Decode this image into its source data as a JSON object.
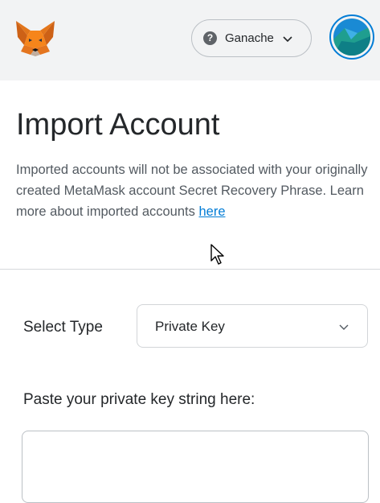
{
  "header": {
    "logo_icon": "metamask-fox-icon",
    "network": {
      "icon": "question-circle-icon",
      "label": "Ganache",
      "chevron_icon": "chevron-down-icon"
    },
    "avatar": {
      "icon": "account-identicon",
      "ring_color": "#037dd6"
    }
  },
  "page": {
    "title": "Import Account",
    "description": "Imported accounts will not be associated with your originally created MetaMask account Secret Recovery Phrase. Learn more about imported accounts ",
    "learn_more_link": "here"
  },
  "form": {
    "select_type_label": "Select Type",
    "select_type_value": "Private Key",
    "paste_label": "Paste your private key string here:",
    "private_key_value": ""
  },
  "colors": {
    "header_bg": "#f2f3f4",
    "link": "#037dd6",
    "text": "#24272a",
    "muted_text": "#535a61"
  }
}
